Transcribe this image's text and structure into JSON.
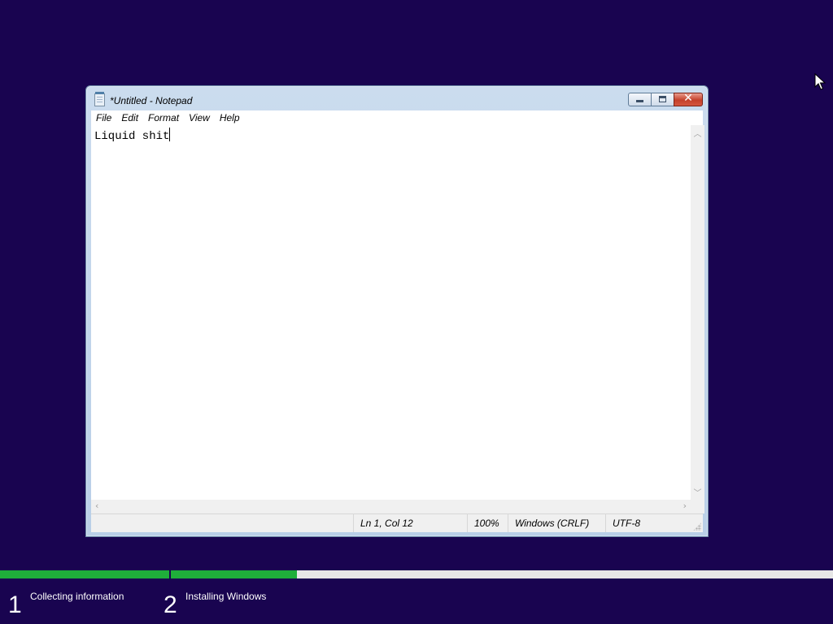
{
  "window": {
    "title": "*Untitled - Notepad",
    "icon": "notepad-icon",
    "caption_buttons": [
      "minimize-icon",
      "maximize-icon",
      "close-icon"
    ]
  },
  "menu": [
    "File",
    "Edit",
    "Format",
    "View",
    "Help"
  ],
  "editor": {
    "text": "Liquid shit"
  },
  "status": {
    "position": "Ln 1, Col 12",
    "zoom": "100%",
    "line_endings": "Windows (CRLF)",
    "encoding": "UTF-8"
  },
  "setup": {
    "steps": [
      {
        "number": "1",
        "label": "Collecting information",
        "progress": 1.0
      },
      {
        "number": "2",
        "label": "Installing Windows",
        "progress": 0.19
      }
    ],
    "colors": {
      "background": "#190450",
      "progress_fill": "#1fae3a",
      "progress_track": "#e6e6e6"
    }
  }
}
